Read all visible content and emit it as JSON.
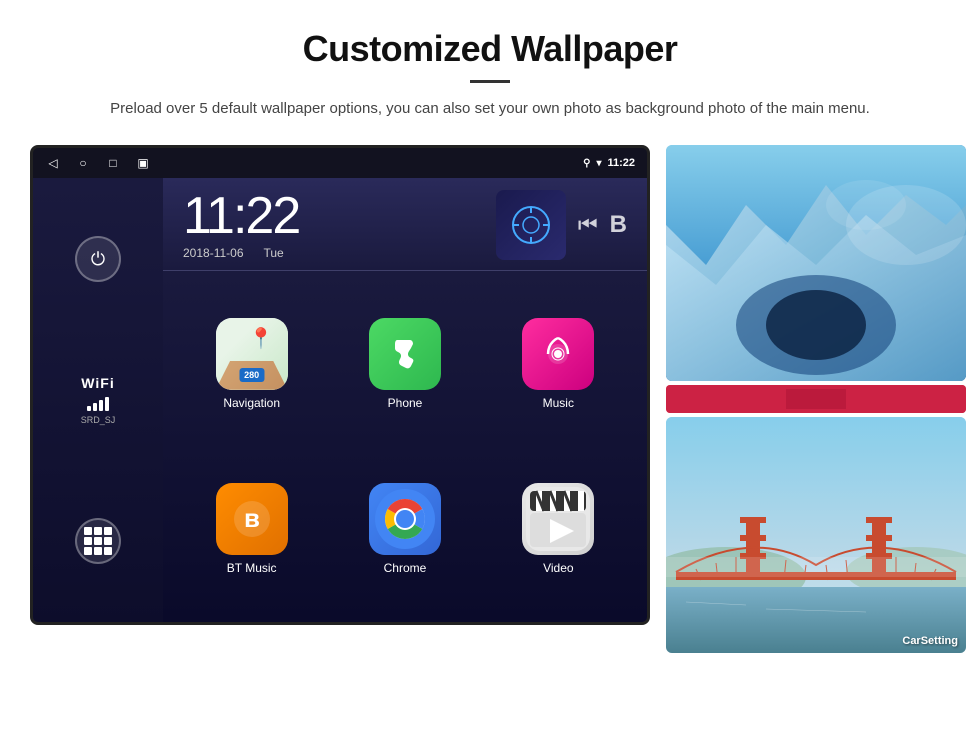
{
  "header": {
    "title": "Customized Wallpaper",
    "subtitle": "Preload over 5 default wallpaper options, you can also set your own photo as background photo of the main menu."
  },
  "android": {
    "status_bar": {
      "nav_back": "◁",
      "nav_home": "○",
      "nav_recent": "□",
      "nav_screenshot": "▣",
      "location_icon": "⚲",
      "wifi_icon": "▾",
      "time": "11:22"
    },
    "clock": {
      "time": "11:22",
      "date": "2018-11-06",
      "day": "Tue"
    },
    "wifi": {
      "label": "WiFi",
      "ssid": "SRD_SJ"
    },
    "apps": [
      {
        "id": "navigation",
        "label": "Navigation",
        "highway": "280"
      },
      {
        "id": "phone",
        "label": "Phone"
      },
      {
        "id": "music",
        "label": "Music"
      },
      {
        "id": "btmusic",
        "label": "BT Music"
      },
      {
        "id": "chrome",
        "label": "Chrome"
      },
      {
        "id": "video",
        "label": "Video"
      }
    ],
    "right_panel": {
      "label": "CarSetting"
    }
  },
  "icons": {
    "power": "⏻",
    "wifi_bars": [
      6,
      10,
      14,
      18
    ],
    "music_note": "♫",
    "back_skip": "⏮",
    "bluetooth": "B",
    "phone_emoji": "📞",
    "music_emoji": "♪",
    "video_emoji": "▶"
  }
}
